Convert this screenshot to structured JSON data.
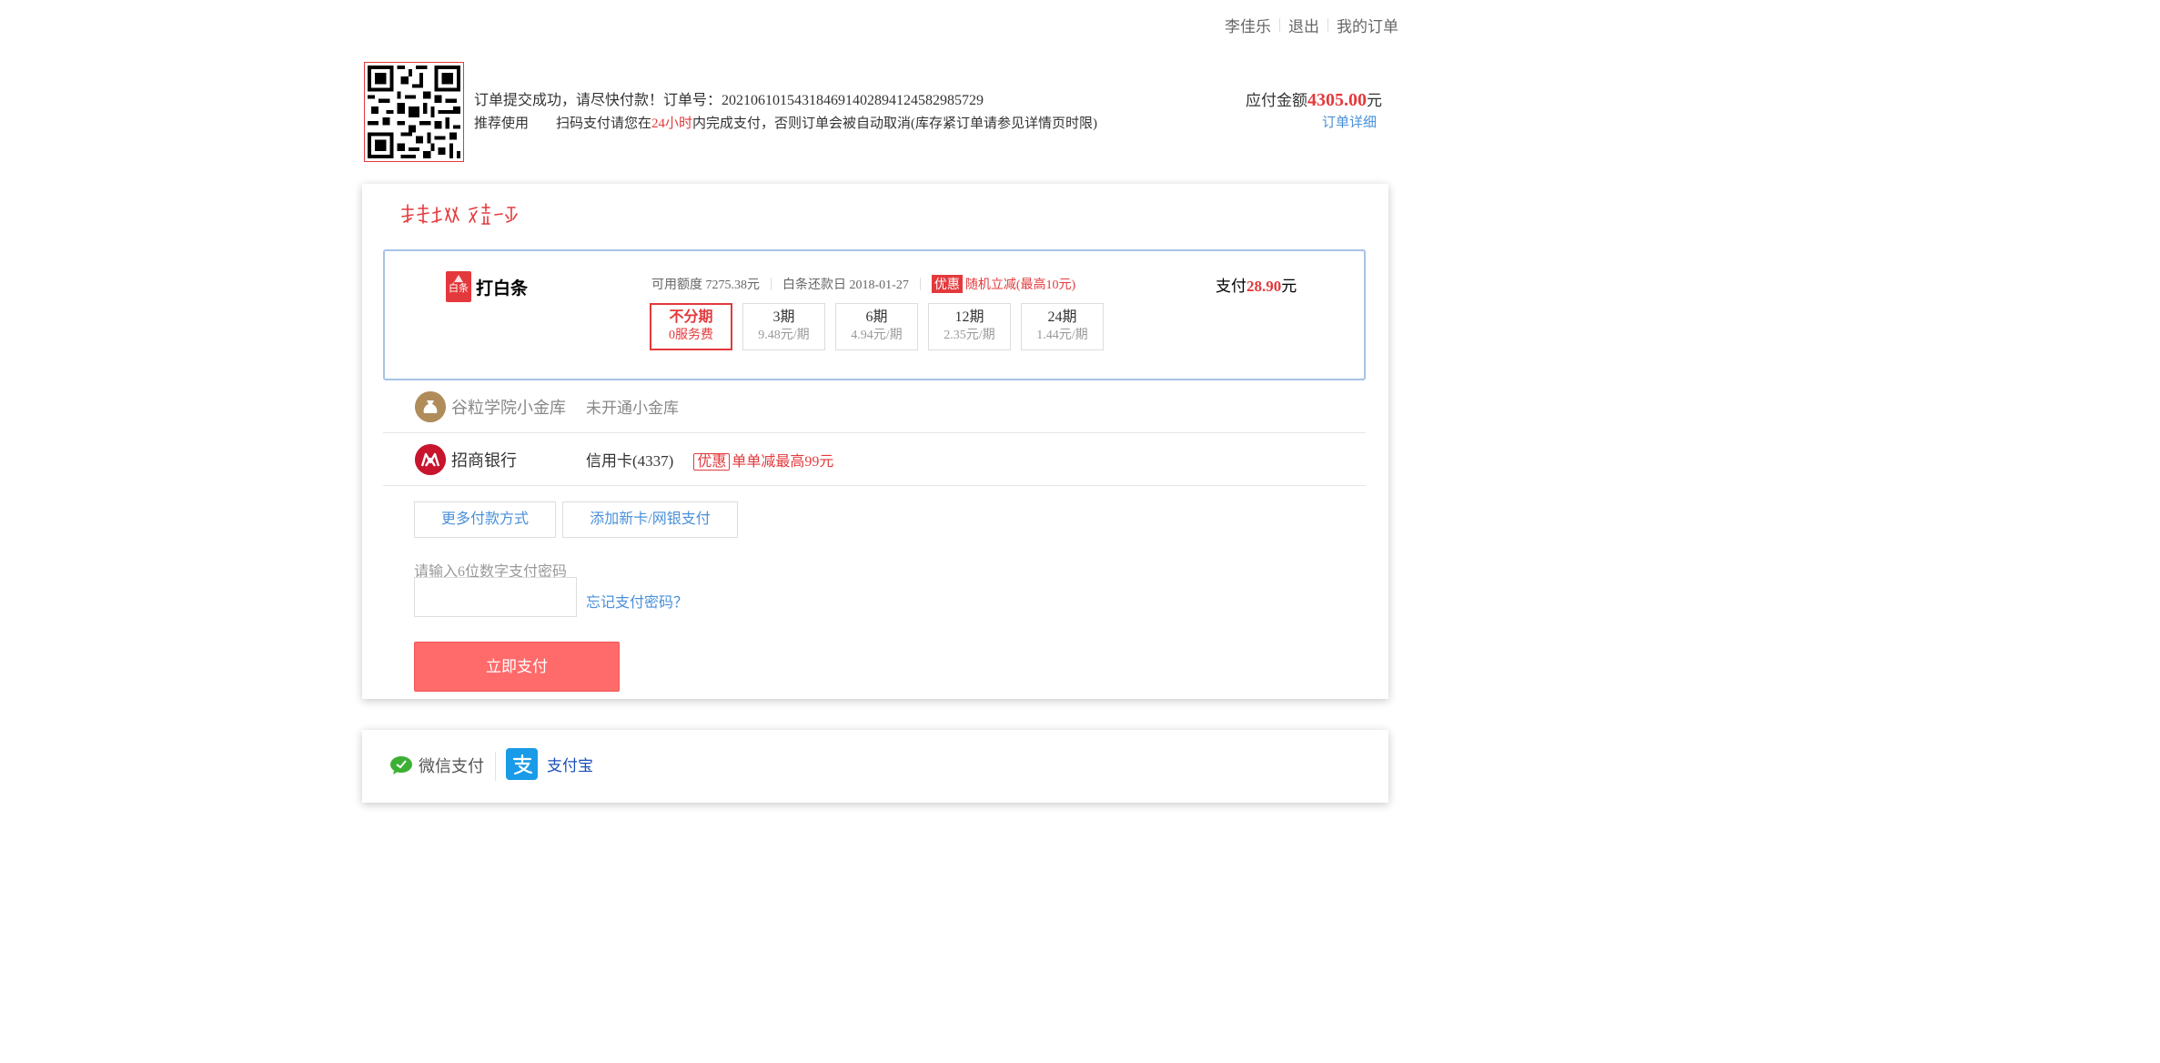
{
  "top_links": {
    "user": "李佳乐",
    "logout": "退出",
    "my_orders": "我的订单"
  },
  "order": {
    "line1": "订单提交成功，请尽快付款！订单号：2021061015431846914028941245829857​29",
    "recommend": "推荐使用",
    "line2_prefix": "扫码支付请您在",
    "line2_hours": "24小时",
    "line2_suffix": "内完成支付，否则订单会被自动取消(库存紧订单请参见详情页时限)",
    "amount_label": "应付金额",
    "amount_value": "4305.00",
    "amount_unit": "元",
    "detail_link": "订单详细"
  },
  "baitiao": {
    "logo_text": "白条",
    "name": "打白条",
    "credit": "可用额度 7275.38元",
    "repay_date": "白条还款日 2018-01-27",
    "promo_badge": "优惠",
    "promo_text": "随机立减(最高10元)",
    "pay_label": "支付",
    "pay_amount": "28.90",
    "pay_unit": "元",
    "plans": [
      {
        "title": "不分期",
        "sub": "0服务费"
      },
      {
        "title": "3期",
        "sub": "9.48元/期"
      },
      {
        "title": "6期",
        "sub": "4.94元/期"
      },
      {
        "title": "12期",
        "sub": "2.35元/期"
      },
      {
        "title": "24期",
        "sub": "1.44元/期"
      }
    ],
    "active_plan": 0
  },
  "methods": {
    "jinku": {
      "name": "谷粒学院小金库",
      "desc": "未开通小金库"
    },
    "bank": {
      "name": "招商银行",
      "desc": "信用卡(4337)",
      "badge": "优惠",
      "promo": "单单减最高99元"
    }
  },
  "buttons": {
    "more": "更多付款方式",
    "add_card": "添加新卡/网银支付",
    "submit": "立即支付"
  },
  "password": {
    "label": "请输入6位数字支付密码",
    "value": "",
    "forgot": "忘记支付密码？"
  },
  "other": {
    "wechat": "微信支付",
    "alipay": "支付宝"
  },
  "colors": {
    "accent_red": "#e4393c",
    "link_blue": "#4a90d9",
    "submit_bg": "#ff6b6b",
    "alipay_blue": "#1a9be8",
    "wechat_green": "#3cb034"
  }
}
